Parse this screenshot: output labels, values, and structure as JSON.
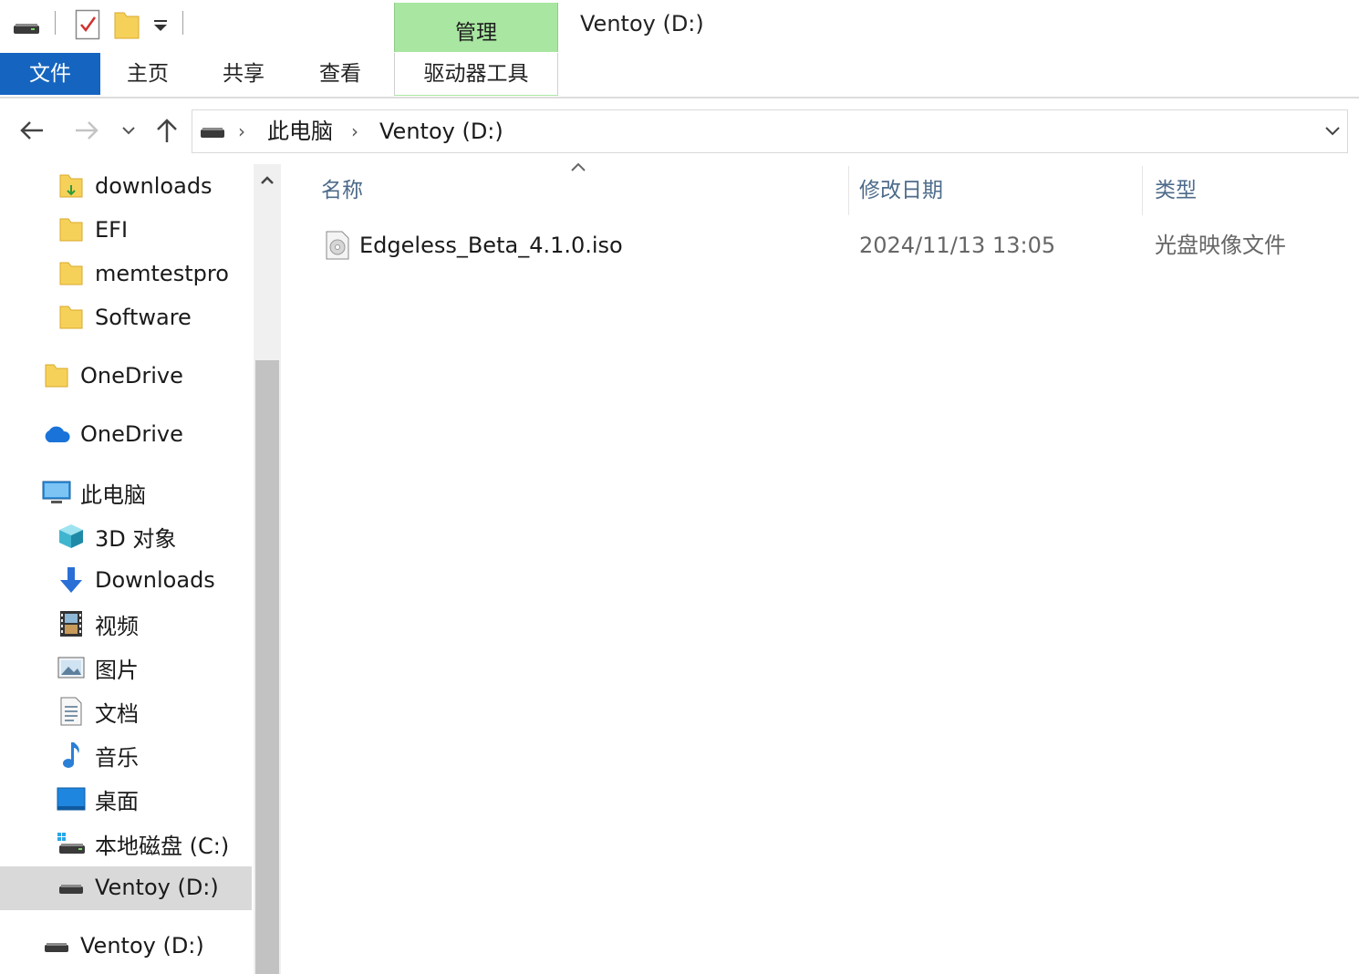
{
  "title_bar": {
    "manage_label": "管理",
    "window_title": "Ventoy (D:)"
  },
  "ribbon": {
    "tabs": [
      {
        "label": "文件",
        "active": true
      },
      {
        "label": "主页"
      },
      {
        "label": "共享"
      },
      {
        "label": "查看"
      },
      {
        "label": "驱动器工具"
      }
    ]
  },
  "address_bar": {
    "breadcrumbs": [
      "此电脑",
      "Ventoy (D:)"
    ]
  },
  "sidebar": {
    "items": [
      {
        "label": "downloads",
        "icon": "folder-icon"
      },
      {
        "label": "EFI",
        "icon": "folder-icon"
      },
      {
        "label": "memtestpro",
        "icon": "folder-icon"
      },
      {
        "label": "Software",
        "icon": "folder-icon"
      },
      {
        "label": "OneDrive",
        "icon": "folder-icon"
      },
      {
        "label": "OneDrive",
        "icon": "cloud-icon"
      },
      {
        "label": "此电脑",
        "icon": "computer-icon"
      },
      {
        "label": "3D 对象",
        "icon": "cube-icon"
      },
      {
        "label": "Downloads",
        "icon": "download-arrow-icon"
      },
      {
        "label": "视频",
        "icon": "film-icon"
      },
      {
        "label": "图片",
        "icon": "picture-icon"
      },
      {
        "label": "文档",
        "icon": "document-icon"
      },
      {
        "label": "音乐",
        "icon": "music-note-icon"
      },
      {
        "label": "桌面",
        "icon": "desktop-icon"
      },
      {
        "label": "本地磁盘 (C:)",
        "icon": "windows-drive-icon"
      },
      {
        "label": "Ventoy (D:)",
        "icon": "drive-icon",
        "selected": true
      },
      {
        "label": "Ventoy (D:)",
        "icon": "drive-icon"
      }
    ]
  },
  "file_list": {
    "columns": [
      "名称",
      "修改日期",
      "类型"
    ],
    "rows": [
      {
        "name": "Edgeless_Beta_4.1.0.iso",
        "modified": "2024/11/13 13:05",
        "type": "光盘映像文件",
        "icon": "disc-image-icon"
      }
    ]
  },
  "colors": {
    "file_tab": "#1565c0",
    "manage_context": "#a8e6a1",
    "selected_item": "#d9d9d9",
    "folder": "#f6d15a"
  }
}
